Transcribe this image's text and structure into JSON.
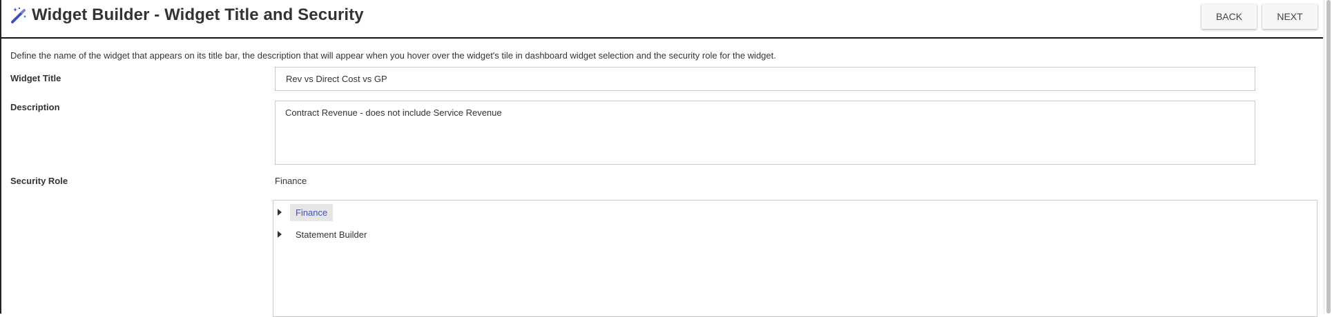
{
  "header": {
    "title": "Widget Builder - Widget Title and Security",
    "icon": "magic-wand-icon",
    "back_label": "BACK",
    "next_label": "NEXT"
  },
  "intro": "Define the name of the widget that appears on its title bar, the description that will appear when you hover over the widget's tile in dashboard widget selection and the security role for the widget.",
  "form": {
    "widget_title_label": "Widget Title",
    "widget_title_value": "Rev vs Direct Cost vs GP",
    "description_label": "Description",
    "description_value": "Contract Revenue - does not include Service Revenue",
    "security_role_label": "Security Role",
    "security_role_value": "Finance"
  },
  "role_tree": {
    "items": [
      {
        "label": "Finance",
        "selected": true
      },
      {
        "label": "Statement Builder",
        "selected": false
      }
    ]
  },
  "colors": {
    "accent": "#3f51b5",
    "selected_bg": "#e6e6e6",
    "border": "#c8c8c8"
  }
}
